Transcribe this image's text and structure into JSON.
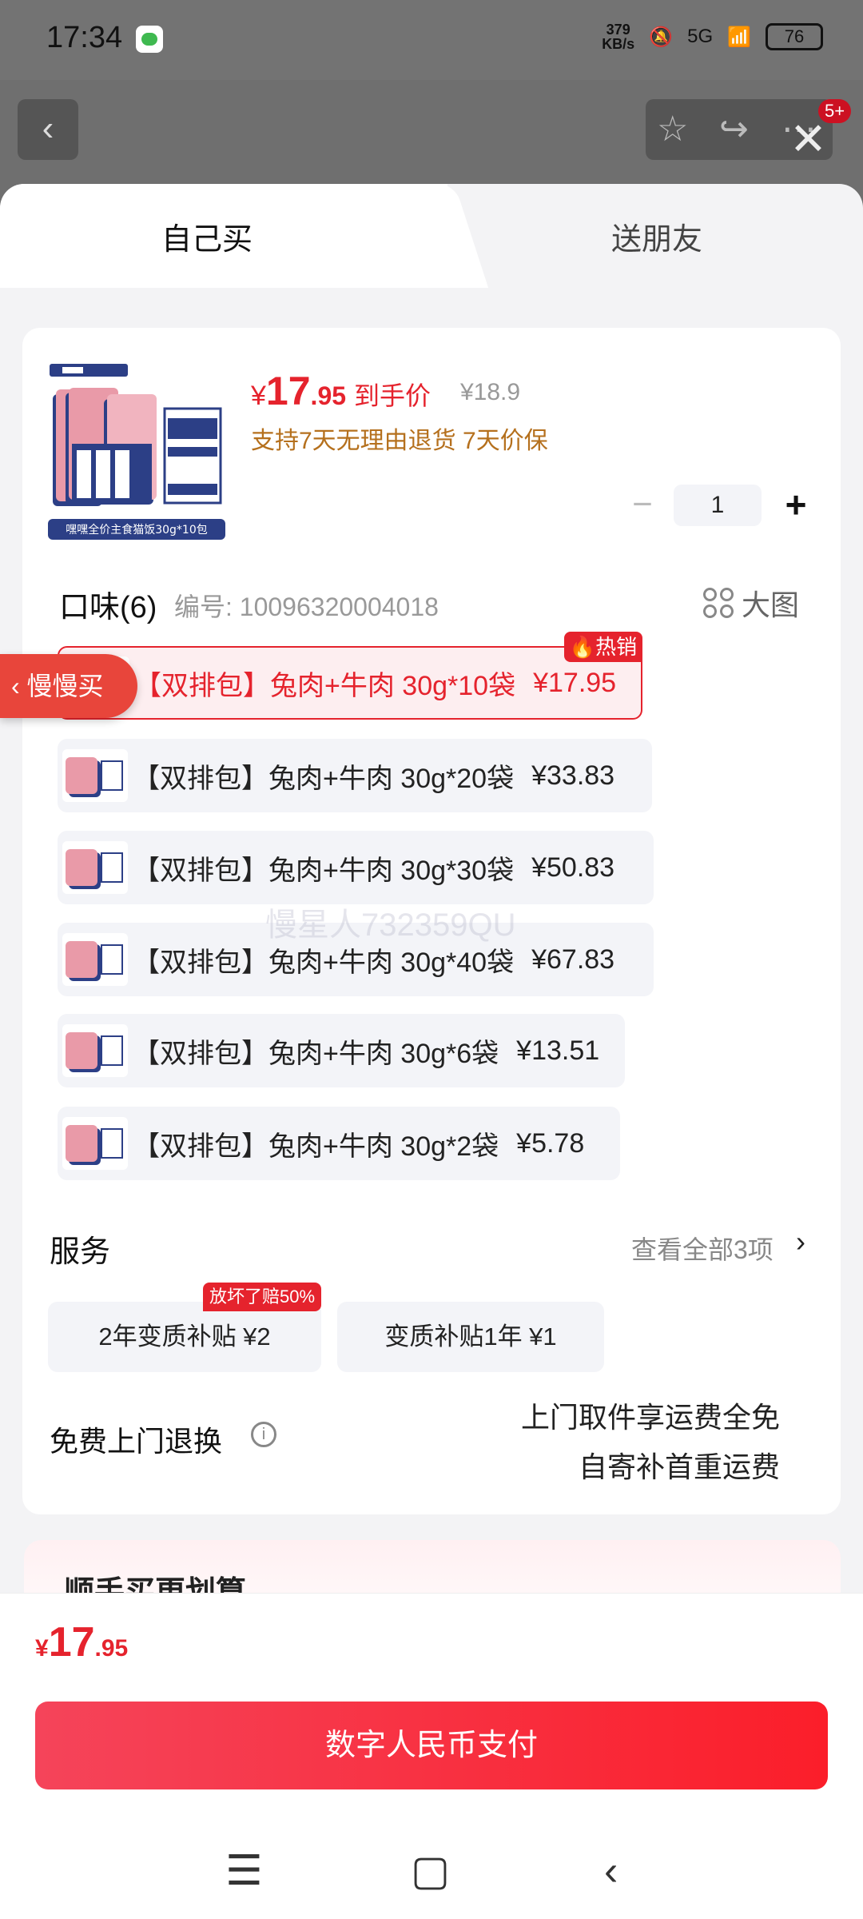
{
  "status": {
    "time": "17:34",
    "speed_top": "379",
    "speed_bottom": "KB/s",
    "network": "5G",
    "battery": "76"
  },
  "nav": {
    "badge": "5+"
  },
  "tabs": {
    "self": "自己买",
    "friend": "送朋友"
  },
  "product": {
    "price_yen": "¥",
    "price_int": "17",
    "price_dec": ".95",
    "price_label": "到手价",
    "original_price": "¥18.9",
    "support": "支持7天无理由退货  7天价保",
    "image_caption": "嘿嘿全价主食猫饭30g*10包",
    "quantity": "1"
  },
  "flavor": {
    "title": "口味(6)",
    "code": "编号: 10096320004018",
    "big_pic": "大图"
  },
  "options": [
    {
      "label": "【双排包】兔肉+牛肉 30g*10袋",
      "price": "¥17.95",
      "selected": true
    },
    {
      "label": "【双排包】兔肉+牛肉 30g*20袋",
      "price": "¥33.83"
    },
    {
      "label": "【双排包】兔肉+牛肉 30g*30袋",
      "price": "¥50.83"
    },
    {
      "label": "【双排包】兔肉+牛肉 30g*40袋",
      "price": "¥67.83"
    },
    {
      "label": "【双排包】兔肉+牛肉 30g*6袋",
      "price": "¥13.51"
    },
    {
      "label": "【双排包】兔肉+牛肉 30g*2袋",
      "price": "¥5.78"
    }
  ],
  "hot_badge": "热销",
  "slow_buy": "慢慢买",
  "watermark": "慢星人732359QU",
  "service": {
    "title": "服务",
    "view_all": "查看全部3项",
    "badge": "放坏了赔50%",
    "items": [
      {
        "label": "2年变质补贴  ¥2"
      },
      {
        "label": "变质补贴1年  ¥1"
      }
    ]
  },
  "free_return": {
    "label": "免费上门退换",
    "line1": "上门取件享运费全免",
    "line2": "自寄补首重运费"
  },
  "more": {
    "title": "顺手买更划算"
  },
  "bottom": {
    "price_yen": "¥",
    "price_int": "17",
    "price_dec": ".95",
    "pay_label": "数字人民币支付"
  }
}
